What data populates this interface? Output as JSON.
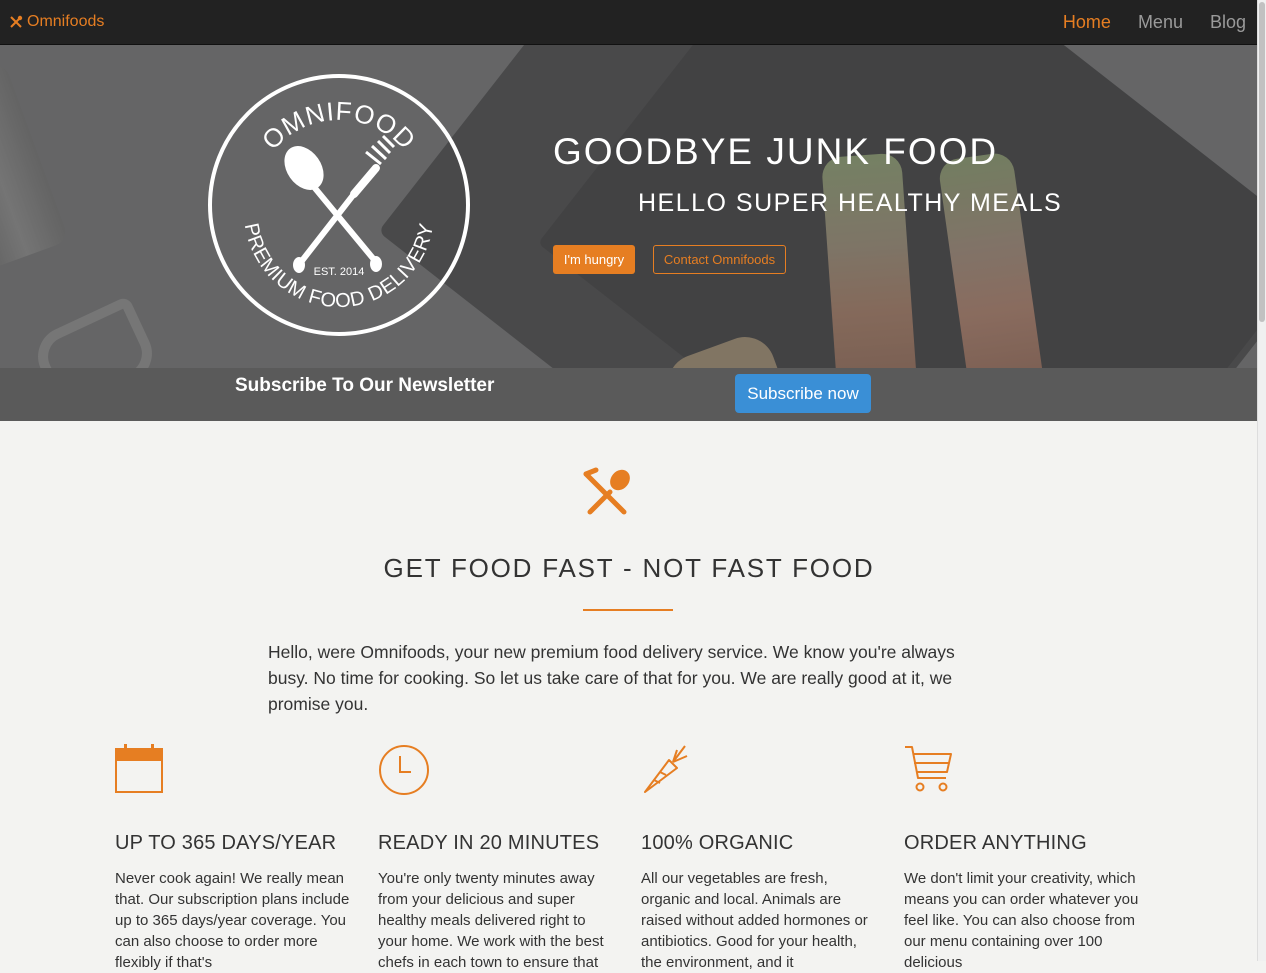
{
  "nav": {
    "brand": "Omnifoods",
    "brand_icon": "cutlery-icon",
    "links": [
      {
        "label": "Home",
        "active": true
      },
      {
        "label": "Menu",
        "active": false
      },
      {
        "label": "Blog",
        "active": false
      }
    ]
  },
  "hero": {
    "logo": {
      "top_text": "OMNIFOOD",
      "est": "EST. 2014",
      "bottom_text": "PREMIUM FOOD DELIVERY"
    },
    "title": "GOODBYE JUNK FOOD",
    "subtitle": "HELLO SUPER HEALTHY MEALS",
    "btn_primary": "I'm hungry",
    "btn_secondary": "Contact Omnifoods"
  },
  "newsletter": {
    "title": "Subscribe To Our Newsletter",
    "button": "Subscribe now"
  },
  "section": {
    "icon": "fork-spoon-icon",
    "title": "GET FOOD FAST - NOT FAST FOOD",
    "intro": "Hello, were Omnifoods, your new premium food delivery service. We know you're always busy. No time for cooking. So let us take care of that for you. We are really good at it, we promise you."
  },
  "features": [
    {
      "icon": "calendar-icon",
      "heading": "UP TO 365 DAYS/YEAR",
      "text": "Never cook again! We really mean that. Our subscription plans include up to 365 days/year coverage. You can also choose to order more flexibly if that's"
    },
    {
      "icon": "clock-icon",
      "heading": "READY IN 20 MINUTES",
      "text": "You're only twenty minutes away from your delicious and super healthy meals delivered right to your home. We work with the best chefs in each town to ensure that"
    },
    {
      "icon": "carrot-icon",
      "heading": "100% ORGANIC",
      "text": "All our vegetables are fresh, organic and local. Animals are raised without added hormones or antibiotics. Good for your health, the environment, and it"
    },
    {
      "icon": "cart-icon",
      "heading": "ORDER ANYTHING",
      "text": "We don't limit your creativity, which means you can order whatever you feel like. You can also choose from our menu containing over 100 delicious"
    }
  ],
  "colors": {
    "accent": "#e67e22",
    "nav_bg": "#222222",
    "newsletter_bg": "#5a5a5a",
    "subscribe_btn": "#3a8fd6",
    "page_bg": "#f3f3f1"
  }
}
